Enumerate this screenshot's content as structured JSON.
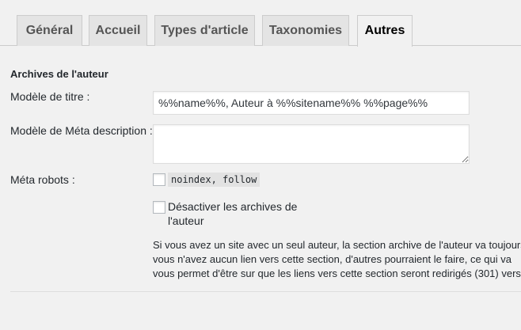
{
  "tabs": [
    {
      "label": "Général"
    },
    {
      "label": "Accueil"
    },
    {
      "label": "Types d'article"
    },
    {
      "label": "Taxonomies"
    },
    {
      "label": "Autres"
    }
  ],
  "active_tab": "Autres",
  "section": {
    "title": "Archives de l'auteur"
  },
  "fields": {
    "title_template": {
      "label": "Modèle de titre :",
      "value": "%%name%%, Auteur à %%sitename%% %%page%%"
    },
    "meta_description": {
      "label": "Modèle de Méta description :",
      "value": ""
    },
    "meta_robots": {
      "label": "Méta robots :",
      "checkbox_text": "noindex, follow",
      "checked": false
    },
    "disable_archives": {
      "label_line1": "Désactiver les archives de",
      "label_line2": "l'auteur",
      "checked": false
    }
  },
  "description": {
    "line1": "Si vous avez un site avec un seul auteur, la section archive de l'auteur va toujours",
    "line2": "vous n'avez aucun lien vers cette section, d'autres pourraient le faire, ce qui va",
    "line3": "vous permet d'être sur que les liens vers cette section seront redirigés (301) vers"
  },
  "colors": {
    "background": "#f1f1f1",
    "tab_inactive": "#e4e4e4",
    "border": "#cccccc"
  }
}
